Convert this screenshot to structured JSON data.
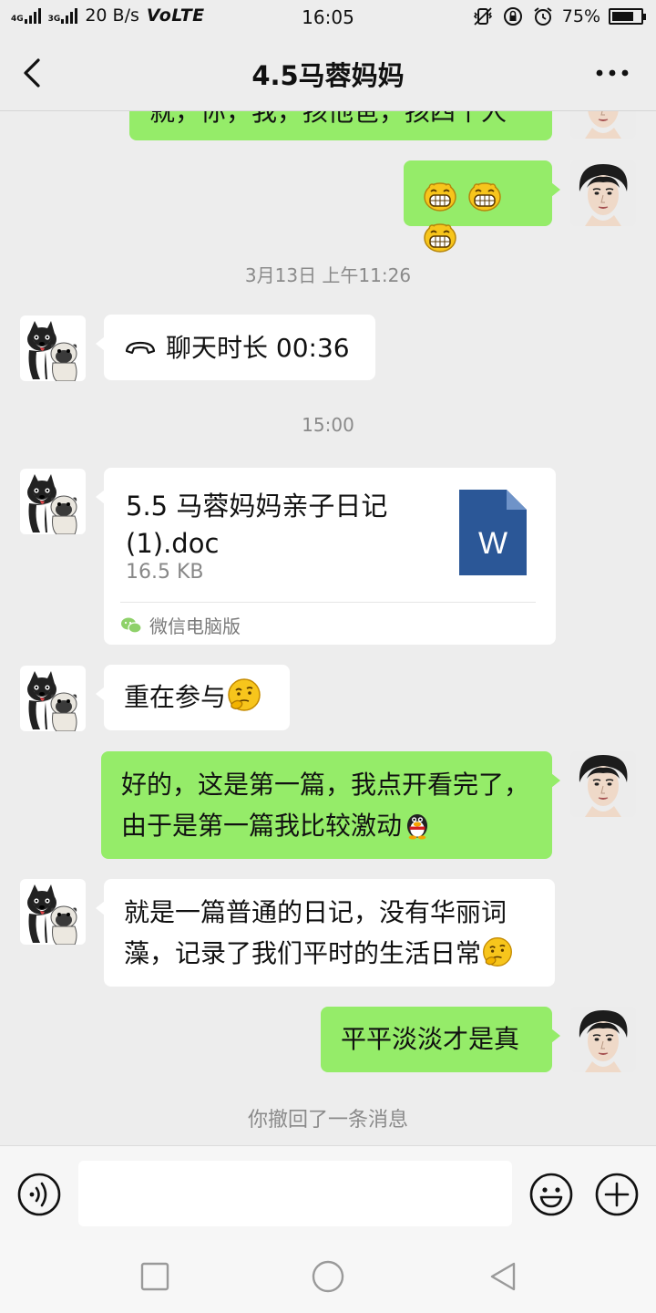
{
  "status_bar": {
    "sig1": "4G",
    "sig2": "3G",
    "speed": "20 B/s",
    "volte": "VoLTE",
    "time": "16:05",
    "battery": "75%",
    "battery_level": 0.75
  },
  "header": {
    "title": "4.5马蓉妈妈"
  },
  "messages": {
    "m0": {
      "text": "就，你，我，孩他爸，孩四个人"
    },
    "ts1": "3月13日 上午11:26",
    "call": {
      "text": "聊天时长 00:36"
    },
    "ts2": "15:00",
    "file": {
      "name": "5.5 马蓉妈妈亲子日记(1).doc",
      "size": "16.5 KB",
      "source": "微信电脑版",
      "icon_letter": "W"
    },
    "m4": {
      "text": "重在参与"
    },
    "m5": {
      "text": "好的，这是第一篇，我点开看完了，由于是第一篇我比较激动"
    },
    "m6": {
      "text": "就是一篇普通的日记，没有华丽词藻，记录了我们平时的生活日常"
    },
    "m7": {
      "text": "平平淡淡才是真"
    },
    "recall": "你撤回了一条消息"
  },
  "input": {
    "placeholder": ""
  },
  "colors": {
    "me_bubble": "#95ec69",
    "other_bubble": "#ffffff",
    "background": "#ededed",
    "word_blue": "#2b5797"
  },
  "icons": [
    "back-icon",
    "more-icon",
    "phone-call-icon",
    "word-doc-icon",
    "wechat-icon",
    "voice-icon",
    "emoji-icon",
    "plus-icon",
    "square-icon",
    "circle-icon",
    "triangle-back-icon"
  ]
}
